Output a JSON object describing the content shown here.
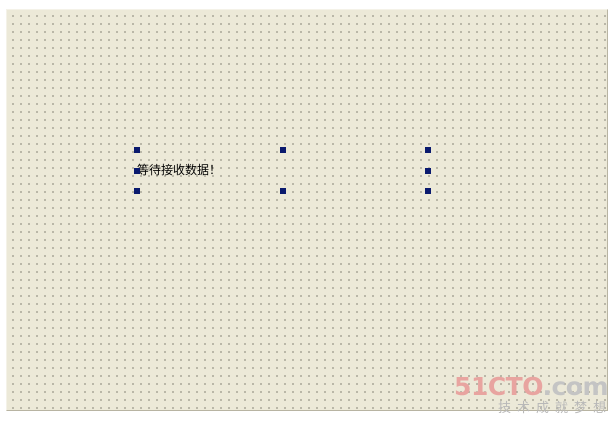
{
  "designer": {
    "label_text": "等待接收数据！",
    "selection_handles": 8
  },
  "watermark": {
    "logo_primary": "51CTO",
    "logo_suffix": ".com",
    "tagline": "技术成就梦想"
  },
  "colors": {
    "canvas_background": "#ece9d8",
    "grid_dot": "#8c8a7e",
    "handle": "#0a1a6e",
    "label_text": "#000000",
    "watermark_accent": "#e8a4a0",
    "watermark_muted": "#c4c4c4"
  }
}
